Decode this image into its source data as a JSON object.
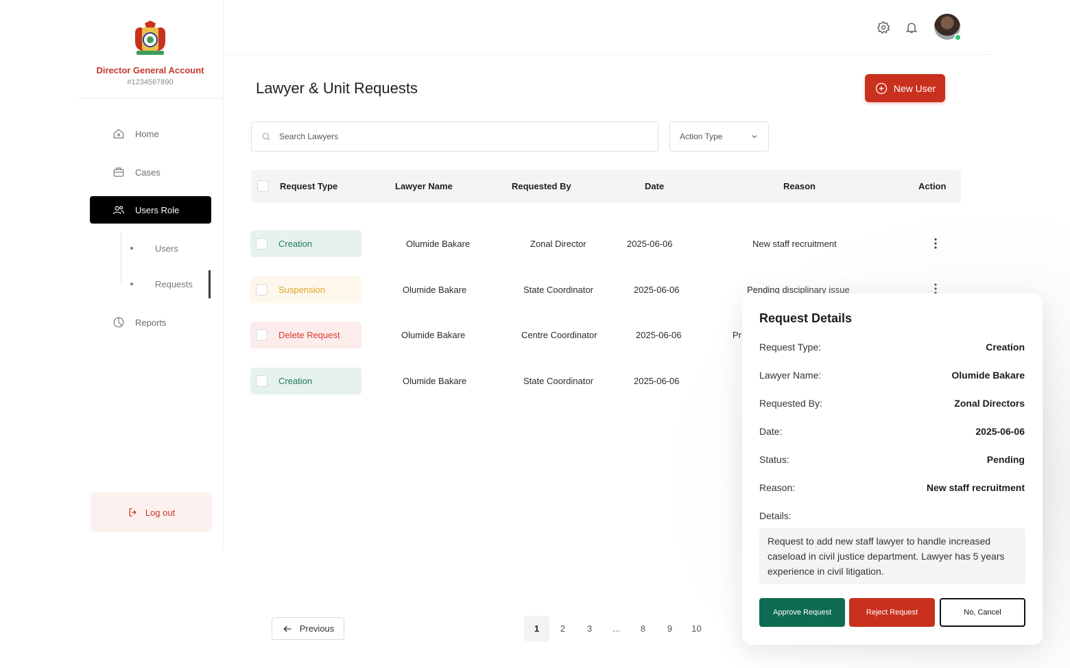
{
  "brand": {
    "name": "Director General Account",
    "id": "#1234567890"
  },
  "sidebar": {
    "items": [
      {
        "label": "Home",
        "icon": "home-icon"
      },
      {
        "label": "Cases",
        "icon": "briefcase-icon"
      },
      {
        "label": "Users Role",
        "icon": "users-icon",
        "active": true
      },
      {
        "label": "Reports",
        "icon": "pie-chart-icon"
      }
    ],
    "sub_items": [
      {
        "label": "Users"
      },
      {
        "label": "Requests",
        "active": true
      }
    ],
    "logout_label": "Log out"
  },
  "header": {
    "icons": [
      "settings-icon",
      "bell-icon"
    ],
    "avatar_status": "online"
  },
  "page": {
    "title": "Lawyer & Unit Requests",
    "new_user_label": "New User"
  },
  "filters": {
    "search_placeholder": "Search Lawyers",
    "action_type_label": "Action Type"
  },
  "table": {
    "headers": [
      "Request Type",
      "Lawyer Name",
      "Requested By",
      "Date",
      "Reason",
      "Action"
    ],
    "rows": [
      {
        "type": "Creation",
        "type_color": "green",
        "lawyer": "Olumide Bakare",
        "requested_by": "Zonal Director",
        "date": "2025-06-06",
        "reason": "New staff recruitment"
      },
      {
        "type": "Suspension",
        "type_color": "yellow",
        "lawyer": "Olumide Bakare",
        "requested_by": "State Coordinator",
        "date": "2025-06-06",
        "reason": "Pending disciplinary issue"
      },
      {
        "type": "Delete Request",
        "type_color": "red",
        "lawyer": "Olumide Bakare",
        "requested_by": "Centre Coordinator",
        "date": "2025-06-06",
        "reason": "Pr"
      },
      {
        "type": "Creation",
        "type_color": "green",
        "lawyer": "Olumide Bakare",
        "requested_by": "State Coordinator",
        "date": "2025-06-06",
        "reason": ""
      }
    ]
  },
  "pagination": {
    "previous_label": "Previous",
    "pages": [
      "1",
      "2",
      "3",
      "...",
      "8",
      "9",
      "10"
    ],
    "current": "1"
  },
  "details": {
    "title": "Request Details",
    "fields": [
      {
        "label": "Request Type:",
        "value": "Creation"
      },
      {
        "label": "Lawyer Name:",
        "value": "Olumide Bakare"
      },
      {
        "label": "Requested By:",
        "value": "Zonal Directors"
      },
      {
        "label": "Date:",
        "value": "2025-06-06"
      },
      {
        "label": "Status:",
        "value": "Pending"
      },
      {
        "label": "Reason:",
        "value": "New staff recruitment"
      }
    ],
    "details_label": "Details:",
    "details_text": "Request to add new staff lawyer to handle increased caseload in civil justice department. Lawyer has 5 years experience in civil litigation.",
    "approve_label": "Approve Request",
    "reject_label": "Reject Request",
    "cancel_label": "No, Cancel"
  },
  "colors": {
    "brand_red": "#c9301d",
    "approve_green": "#0f6b52",
    "pill_green": "#1e7a5a",
    "pill_yellow": "#e0a324",
    "pill_red": "#d93a2f"
  }
}
